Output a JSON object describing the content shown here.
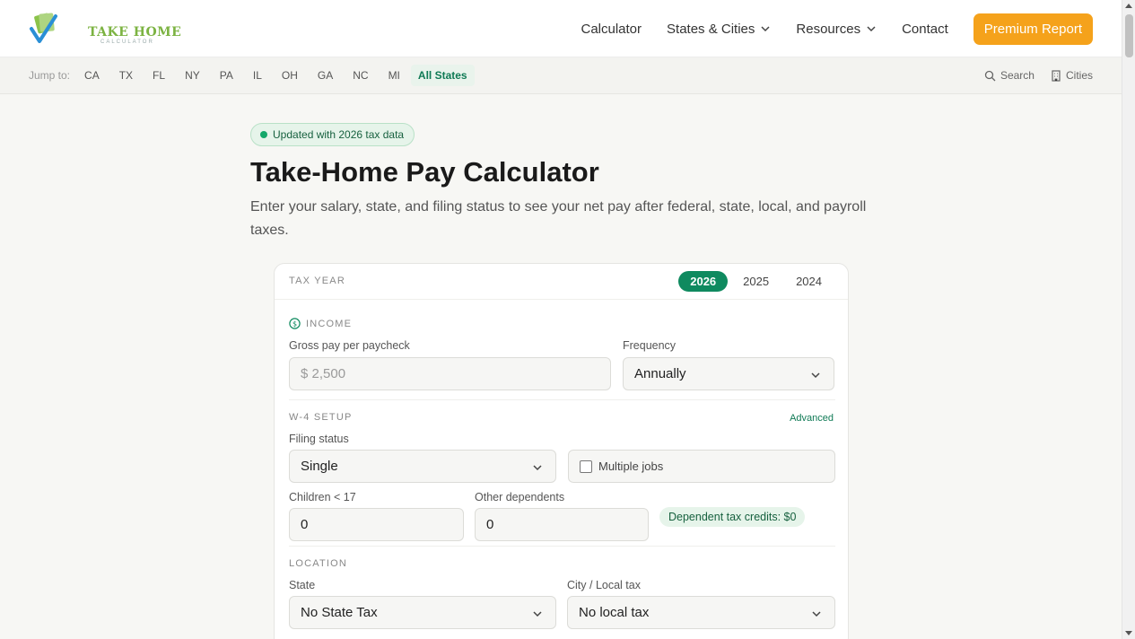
{
  "brand": {
    "name": "TAKE HOME",
    "sub": "CALCULATOR",
    "accent": "#7cb342"
  },
  "nav": {
    "items": [
      {
        "label": "Calculator",
        "has_dropdown": false
      },
      {
        "label": "States & Cities",
        "has_dropdown": true
      },
      {
        "label": "Resources",
        "has_dropdown": true
      },
      {
        "label": "Contact",
        "has_dropdown": false
      }
    ],
    "premium_label": "Premium Report",
    "premium_color": "#f5a21b"
  },
  "jumpbar": {
    "label": "Jump to:",
    "states": [
      "CA",
      "TX",
      "FL",
      "NY",
      "PA",
      "IL",
      "OH",
      "GA",
      "NC",
      "MI"
    ],
    "all_label": "All States",
    "search_label": "Search",
    "cities_label": "Cities"
  },
  "hero": {
    "badge": "Updated with 2026 tax data",
    "title": "Take-Home Pay Calculator",
    "subtitle": "Enter your salary, state, and filing status to see your net pay after federal, state, local, and payroll taxes."
  },
  "card": {
    "tax_year_label": "TAX YEAR",
    "years": [
      "2026",
      "2025",
      "2024"
    ],
    "active_year": "2026",
    "income": {
      "section": "INCOME",
      "gross_label": "Gross pay per paycheck",
      "gross_placeholder": "$ 2,500",
      "frequency_label": "Frequency",
      "frequency_value": "Annually"
    },
    "w4": {
      "section": "W-4 SETUP",
      "advanced": "Advanced",
      "filing_label": "Filing status",
      "filing_value": "Single",
      "multiple_jobs": "Multiple jobs",
      "children_label": "Children < 17",
      "children_value": "0",
      "dependents_label": "Other dependents",
      "dependents_value": "0",
      "credits": "Dependent tax credits: $0"
    },
    "location": {
      "section": "LOCATION",
      "state_label": "State",
      "state_value": "No State Tax",
      "city_label": "City / Local tax",
      "city_value": "No local tax"
    }
  }
}
